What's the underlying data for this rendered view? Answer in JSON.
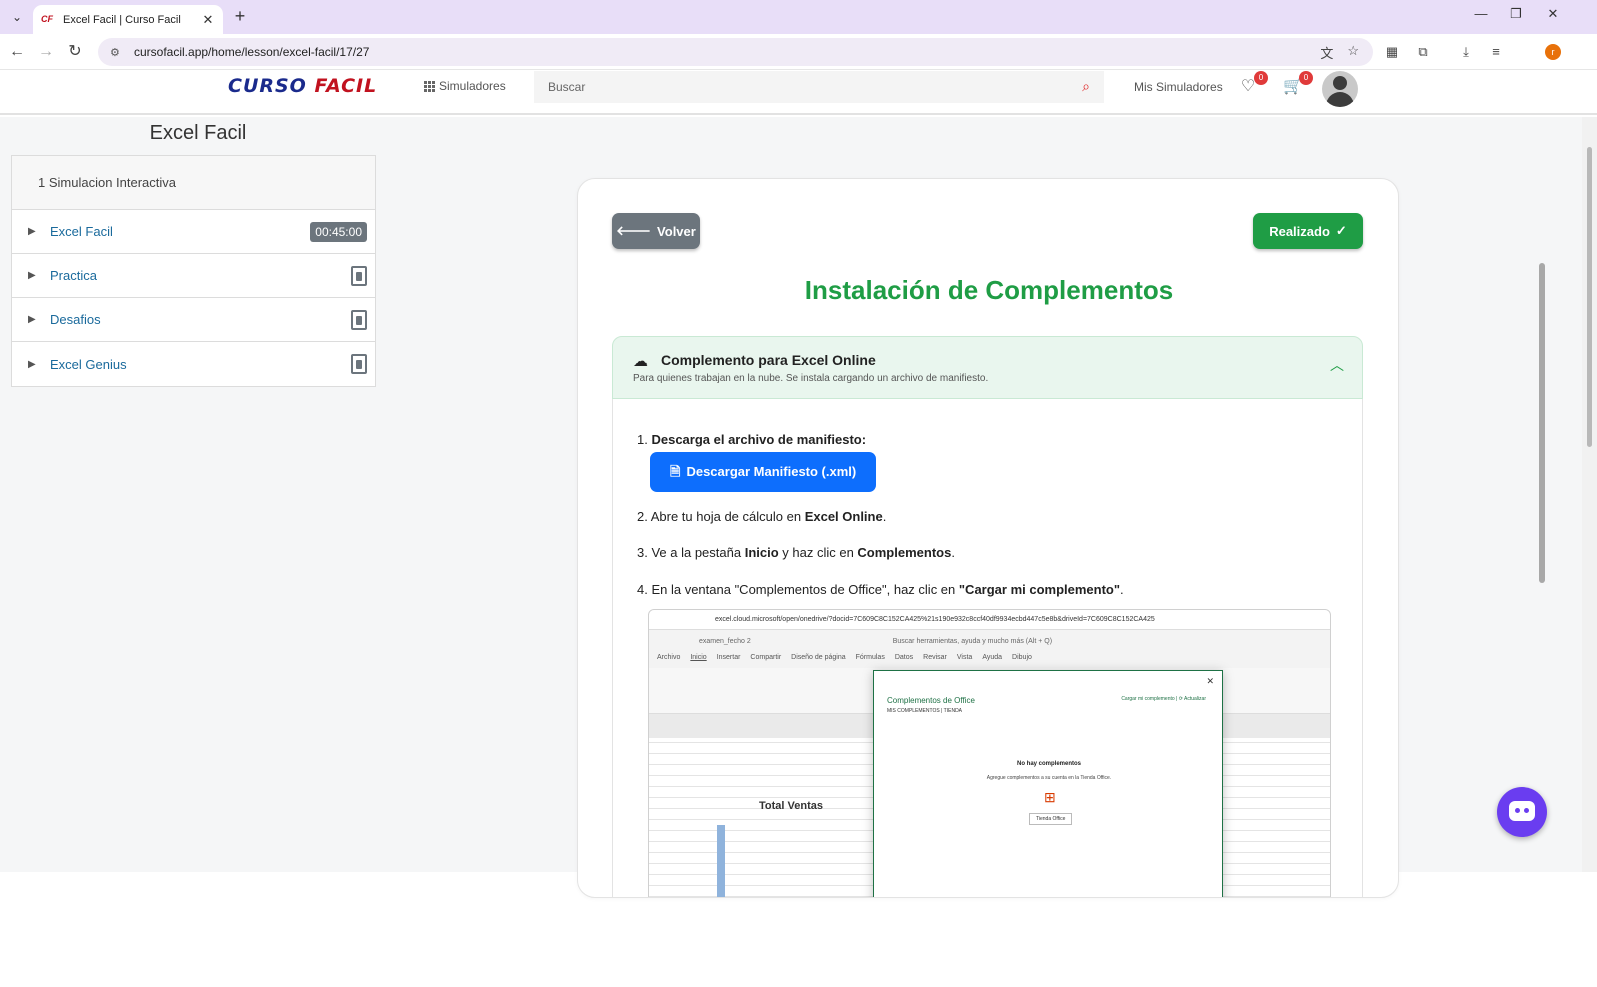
{
  "browser": {
    "tab_title": "Excel Facil | Curso Facil",
    "tab_favicon": "CF",
    "new_tab": "+",
    "url": "cursofacil.app/home/lesson/excel-facil/17/27",
    "profile_initial": "r"
  },
  "header": {
    "logo_part1": "CURSO ",
    "logo_part2": "FACIL",
    "simuladores": "Simuladores",
    "search_placeholder": "Buscar",
    "mis_simuladores": "Mis Simuladores",
    "wishlist_count": "0",
    "cart_count": "0"
  },
  "sidebar": {
    "course_title": "Excel Facil",
    "section_title": "1 Simulacion Interactiva",
    "items": [
      {
        "label": "Excel Facil",
        "badge": "00:45:00"
      },
      {
        "label": "Practica"
      },
      {
        "label": "Desafios"
      },
      {
        "label": "Excel Genius"
      }
    ]
  },
  "lesson": {
    "back_label": "Volver",
    "done_label": "Realizado",
    "title": "Instalación de Complementos",
    "accordion": {
      "title": "Complemento para Excel Online",
      "subtitle": "Para quienes trabajan en la nube. Se instala cargando un archivo de manifiesto."
    },
    "steps": {
      "s1_prefix": "1. ",
      "s1_bold": "Descarga el archivo de manifiesto:",
      "download_label": "Descargar Manifiesto (.xml)",
      "s2_a": "2. Abre tu hoja de cálculo en ",
      "s2_b": "Excel Online",
      "s2_c": ".",
      "s3_a": "3. Ve a la pestaña ",
      "s3_b": "Inicio",
      "s3_c": " y haz clic en ",
      "s3_d": "Complementos",
      "s3_e": ".",
      "s4_a": "4. En la ventana \"Complementos de Office\", haz clic en ",
      "s4_b": "\"Cargar mi complemento\"",
      "s4_c": "."
    },
    "screenshot": {
      "url": "excel.cloud.microsoft/open/onedrive/?docid=7C609C8C152CA425%21s190e932c8ccf40df9934ecbd447c5e8b&driveId=7C609C8C152CA425",
      "file_name": "examen_fecho 2",
      "search_hint": "Buscar herramientas, ayuda y mucho más (Alt + Q)",
      "tabs": [
        "Archivo",
        "Inicio",
        "Insertar",
        "Compartir",
        "Diseño de página",
        "Fórmulas",
        "Datos",
        "Revisar",
        "Vista",
        "Ayuda",
        "Dibujo"
      ],
      "chart_title": "Total Ventas",
      "dialog_title": "Complementos de Office",
      "dialog_tabs": "MIS COMPLEMENTOS  |  TIENDA",
      "dialog_links": "Cargar mi complemento  |  ⟳ Actualizar",
      "dialog_empty": "No hay complementos",
      "dialog_empty_sub": "Agregue complementos a su cuenta en la Tienda Office.",
      "dialog_store_btn": "Tienda Office"
    }
  }
}
